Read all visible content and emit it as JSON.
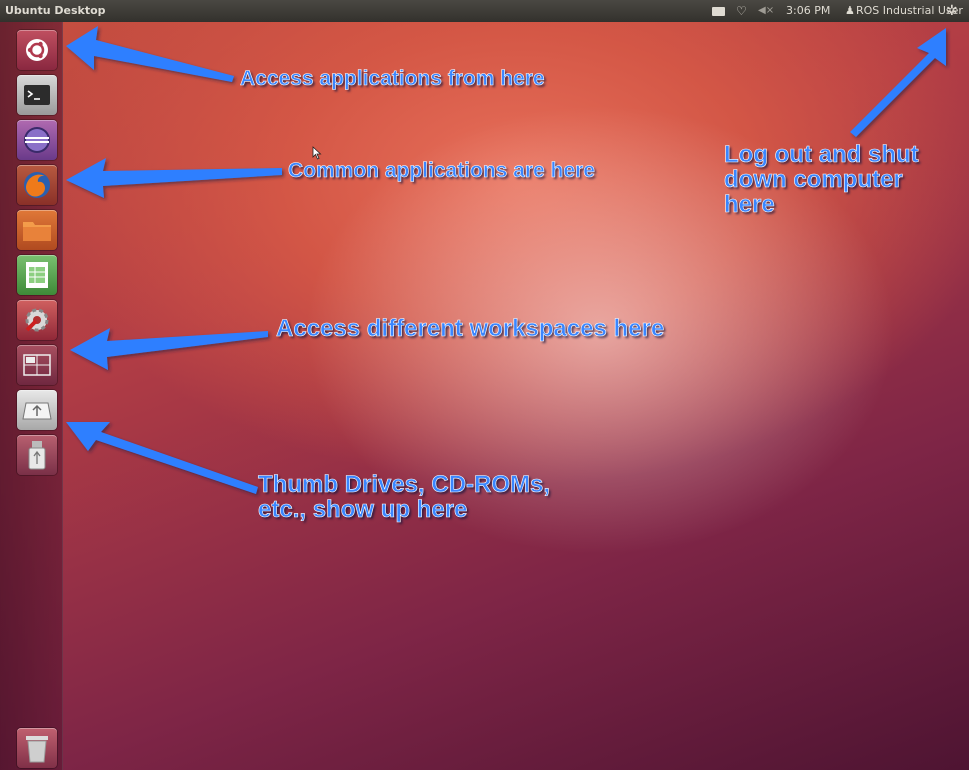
{
  "top_panel": {
    "title": "Ubuntu Desktop",
    "clock": "3:06 PM",
    "user": "ROS Industrial User",
    "icons": [
      "mail-icon",
      "network-icon",
      "volume-icon",
      "user-icon",
      "session-gear-icon"
    ]
  },
  "launcher": {
    "items": [
      {
        "name": "dash-home",
        "icon": "ubuntu-logo-icon"
      },
      {
        "name": "terminal",
        "icon": "terminal-icon",
        "label": ">_"
      },
      {
        "name": "eclipse",
        "icon": "eclipse-icon"
      },
      {
        "name": "firefox",
        "icon": "firefox-icon"
      },
      {
        "name": "files",
        "icon": "folder-icon"
      },
      {
        "name": "libreoffice-calc",
        "icon": "spreadsheet-icon"
      },
      {
        "name": "system-settings",
        "icon": "settings-icon"
      },
      {
        "name": "workspace-switcher",
        "icon": "workspace-icon"
      },
      {
        "name": "removable-drive",
        "icon": "usb-drive-icon"
      },
      {
        "name": "thumb-drive",
        "icon": "usb-stick-icon"
      },
      {
        "name": "trash",
        "icon": "trash-icon"
      }
    ]
  },
  "annotations": {
    "applications": "Access applications from here",
    "common": "Common applications are here",
    "workspaces": "Access different workspaces here",
    "drives_line1": "Thumb Drives, CD-ROMs,",
    "drives_line2": "etc., show up here",
    "logout_line1": "Log out and shut",
    "logout_line2": "down computer",
    "logout_line3": "here"
  },
  "colors": {
    "annotation_text": "#3a86ff",
    "arrow": "#2f7fff",
    "panel": "#3c3b37",
    "wallpaper_primary": "#c8503f",
    "wallpaper_dark": "#4e1432"
  }
}
